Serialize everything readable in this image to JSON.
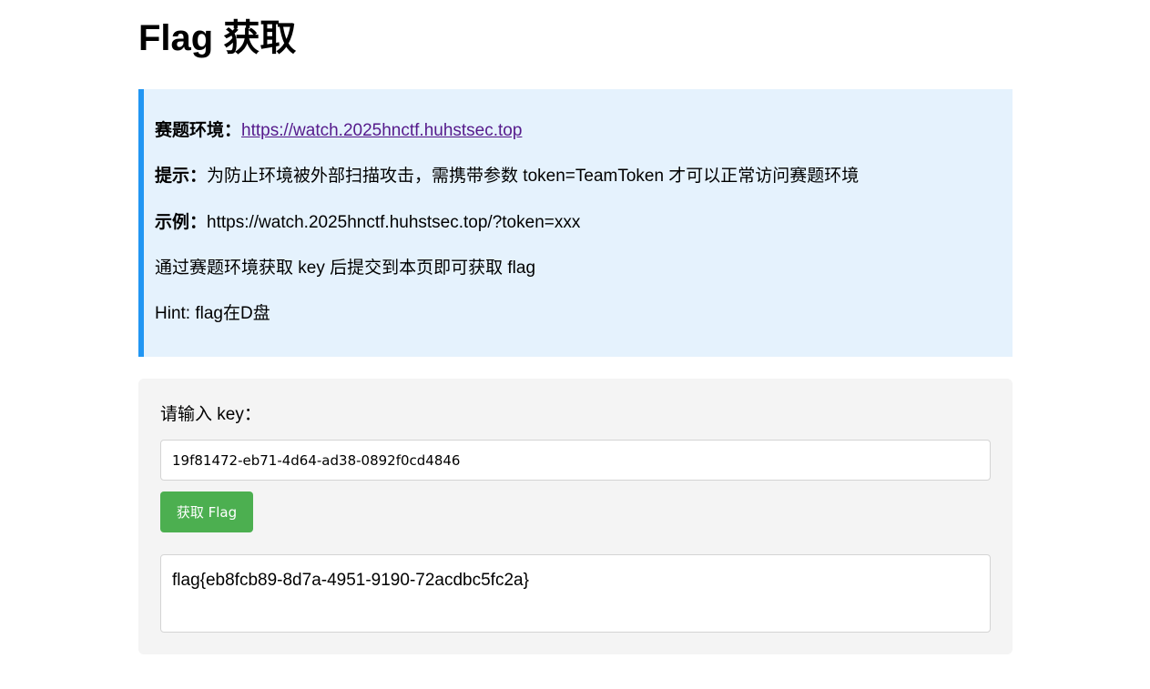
{
  "page": {
    "title": "Flag 获取"
  },
  "info": {
    "env_label": "赛题环境：",
    "env_url": "https://watch.2025hnctf.huhstsec.top",
    "hint_label": "提示：",
    "hint_text": "为防止环境被外部扫描攻击，需携带参数 token=TeamToken 才可以正常访问赛题环境",
    "example_label": "示例：",
    "example_text": "https://watch.2025hnctf.huhstsec.top/?token=xxx",
    "instruction": "通过赛题环境获取 key 后提交到本页即可获取 flag",
    "extra_hint": "Hint: flag在D盘"
  },
  "form": {
    "key_label": "请输入 key：",
    "key_value": "19f81472-eb71-4d64-ad38-0892f0cd4846",
    "submit_label": "获取 Flag",
    "result": "flag{eb8fcb89-8d7a-4951-9190-72acdbc5fc2a}"
  },
  "colors": {
    "accent_border": "#2196f3",
    "info_background": "#e5f2fd",
    "button_background": "#4caf50",
    "panel_background": "#f4f4f4",
    "link": "#551a8b"
  }
}
